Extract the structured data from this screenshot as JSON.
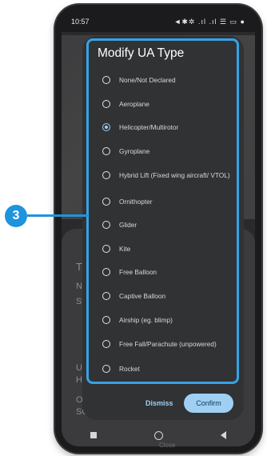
{
  "status": {
    "time": "10:57",
    "icons_text": "◄✱✲ .ıl .ıl ☰ ▭ ●"
  },
  "dialog": {
    "title": "Modify UA Type",
    "options": [
      {
        "label": "None/Not Declared",
        "selected": false
      },
      {
        "label": "Aeroplane",
        "selected": false
      },
      {
        "label": "Helicopter/Multirotor",
        "selected": true
      },
      {
        "label": "Gyroplane",
        "selected": false
      },
      {
        "label": "Hybrid Lift (Fixed wing aircraft/ VTOL)",
        "selected": false
      },
      {
        "label": "Ornithopter",
        "selected": false
      },
      {
        "label": "Glider",
        "selected": false
      },
      {
        "label": "Kite",
        "selected": false
      },
      {
        "label": "Free Balloon",
        "selected": false
      },
      {
        "label": "Captive Balloon",
        "selected": false
      },
      {
        "label": "Airship (eg. blimp)",
        "selected": false
      },
      {
        "label": "Free Fall/Parachute (unpowered)",
        "selected": false
      },
      {
        "label": "Rocket",
        "selected": false
      }
    ],
    "dismiss_label": "Dismiss",
    "confirm_label": "Confirm"
  },
  "background": {
    "t1": "Tr",
    "t2": "Na",
    "t3": "St",
    "t4": "UA",
    "t5": "He",
    "t6": "Op",
    "t7": "SC",
    "close_hint": "Close"
  },
  "callout": {
    "number": "3"
  },
  "colors": {
    "accent": "#9fd0f4",
    "highlight": "#35a3e6",
    "badge": "#1f93dc"
  }
}
